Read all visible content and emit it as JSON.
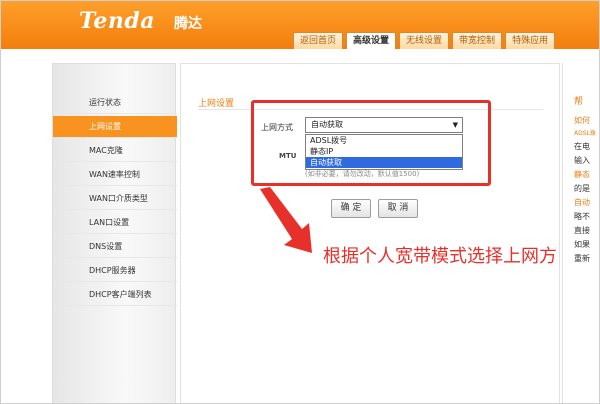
{
  "header": {
    "logo": "Tenda",
    "logo_cn": "腾达",
    "tabs": [
      "返回首页",
      "高级设置",
      "无线设置",
      "带宽控制",
      "特殊应用"
    ]
  },
  "nav": {
    "items": [
      "运行状态",
      "上网设置",
      "MAC克隆",
      "WAN速率控制",
      "WAN口介质类型",
      "LAN口设置",
      "DNS设置",
      "DHCP服务器",
      "DHCP客户端列表"
    ]
  },
  "content": {
    "section_title": "上网设置",
    "connection_label": "上网方式",
    "select_value": "自动获取",
    "options": [
      "ADSL拨号",
      "静态IP",
      "自动获取"
    ],
    "mtu_label": "MTU",
    "mtu_hint": "(如非必要，请勿改动，默认值1500)",
    "ok_button": "确 定",
    "cancel_button": "取 消"
  },
  "annotation": "根据个人宽带模式选择上网方",
  "help": {
    "title": "帮",
    "lines": [
      "如何",
      "ADSL拨",
      "在电",
      "输入",
      "静态",
      "的是",
      "自动",
      "略不",
      "直接",
      "如果",
      "重新"
    ]
  },
  "colors": {
    "header_orange": "#f37e0c",
    "nav_active": "#f7931e",
    "annotation_red": "#e8302a",
    "selected_option": "#2f6bdf"
  }
}
